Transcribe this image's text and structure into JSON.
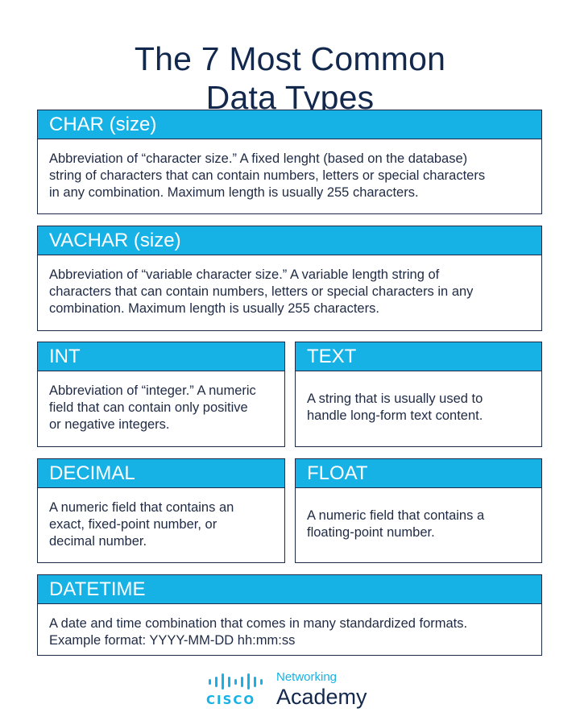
{
  "title": {
    "line1": "The 7 Most Common",
    "line2": "Data Types"
  },
  "cards": {
    "char": {
      "heading": "CHAR (size)",
      "lines": [
        "Abbreviation of “character size.” A fixed lenght (based on the database)",
        "string of characters that can contain numbers, letters or special characters",
        "in any combination. Maximum length is usually 255 characters."
      ]
    },
    "varchar": {
      "heading": "VACHAR (size)",
      "lines": [
        "Abbreviation of “variable character size.” A variable length string of",
        "characters that can contain numbers, letters or special characters in any",
        "combination. Maximum length is usually 255 characters."
      ]
    },
    "int": {
      "heading": "INT",
      "lines": [
        "Abbreviation of “integer.” A numeric",
        "field that can contain only positive",
        "or negative integers."
      ]
    },
    "text": {
      "heading": "TEXT",
      "lines": [
        "A string that is usually used to",
        "handle long-form text content."
      ]
    },
    "decimal": {
      "heading": "DECIMAL",
      "lines": [
        "A numeric field that contains an",
        "exact, fixed-point number, or",
        "decimal number."
      ]
    },
    "float": {
      "heading": "FLOAT",
      "lines": [
        "A numeric field that contains a",
        "floating-point number."
      ]
    },
    "datetime": {
      "heading": "DATETIME",
      "lines": [
        "A date and time combination that comes in many standardized formats.",
        "Example format: YYYY-MM-DD hh:mm:ss"
      ]
    }
  },
  "logo": {
    "brand": "CISCO",
    "line1": "Networking",
    "line2": "Academy",
    "icon": "cisco-bars-icon"
  },
  "colors": {
    "accent": "#16b2e6",
    "text": "#13284d",
    "border": "#1f2a44"
  }
}
